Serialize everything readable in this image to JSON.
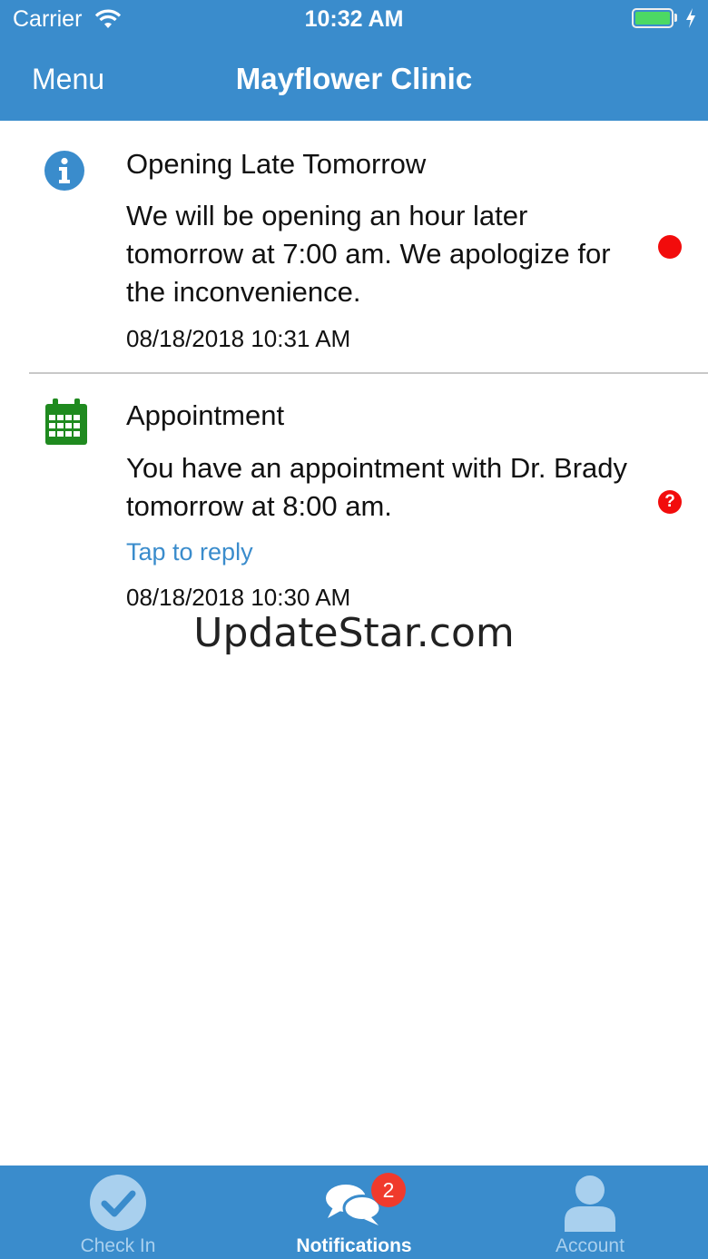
{
  "status_bar": {
    "carrier": "Carrier",
    "time": "10:32 AM"
  },
  "nav": {
    "menu_label": "Menu",
    "title": "Mayflower Clinic"
  },
  "notifications": [
    {
      "icon": "info-icon",
      "title": "Opening Late Tomorrow",
      "body": "We will be opening an hour later tomorrow at 7:00 am. We apologize for the inconvenience.",
      "timestamp": "08/18/2018 10:31 AM",
      "indicator": "unread-dot"
    },
    {
      "icon": "calendar-icon",
      "title": "Appointment",
      "body": "You have an appointment with Dr. Brady tomorrow at 8:00 am.",
      "reply_label": "Tap to reply",
      "timestamp": "08/18/2018 10:30 AM",
      "indicator": "question-icon",
      "indicator_glyph": "?"
    }
  ],
  "watermark": "UpdateStar.com",
  "tabs": [
    {
      "label": "Check In",
      "icon": "check-circle-icon",
      "active": false
    },
    {
      "label": "Notifications",
      "icon": "chat-bubbles-icon",
      "active": true,
      "badge": "2"
    },
    {
      "label": "Account",
      "icon": "person-icon",
      "active": false
    }
  ],
  "colors": {
    "brand": "#3a8ccc",
    "info_icon": "#3a8ccc",
    "calendar_icon": "#1f8a1f",
    "alert_red": "#f20c0c",
    "badge_red": "#f03a2c"
  }
}
